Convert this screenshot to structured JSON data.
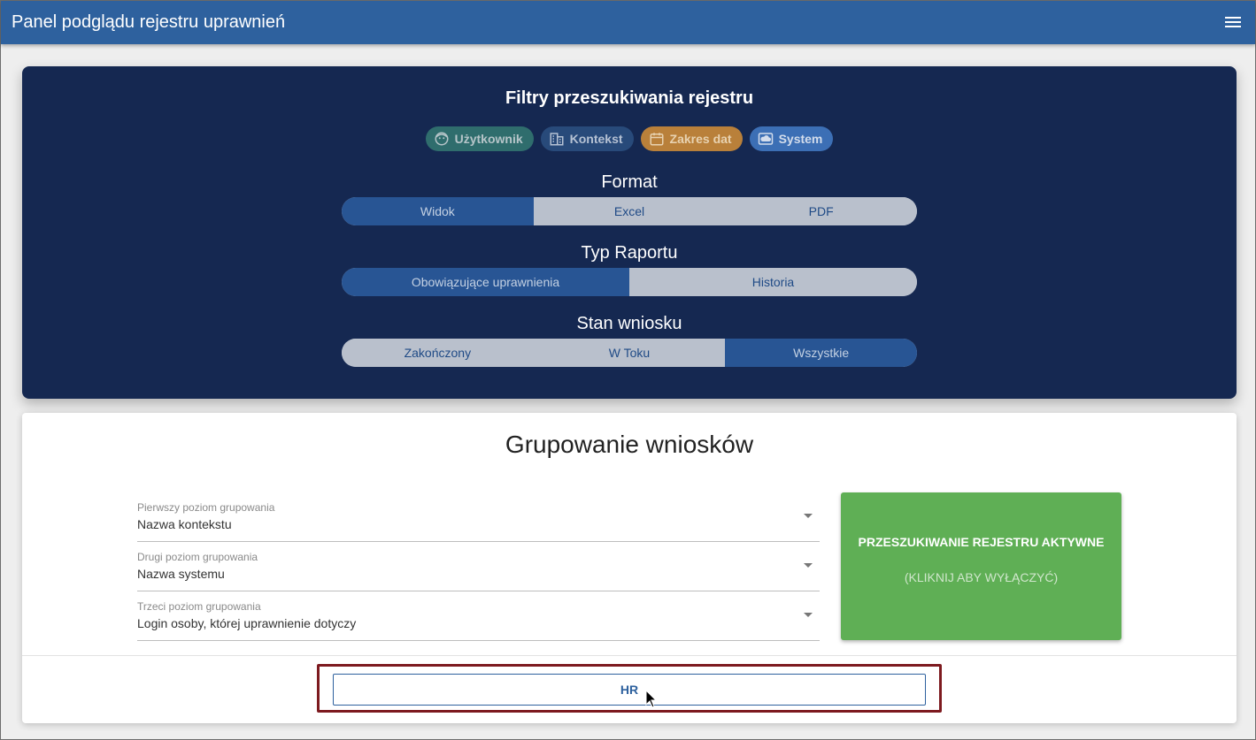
{
  "app_bar": {
    "title": "Panel podglądu rejestru uprawnień",
    "menu_icon": "hamburger-menu-icon"
  },
  "filters": {
    "title": "Filtry przeszukiwania rejestru",
    "chips": [
      {
        "label": "Użytkownik",
        "icon": "face-icon",
        "color": "#2f6d6d"
      },
      {
        "label": "Kontekst",
        "icon": "building-icon",
        "color": "#284a7a"
      },
      {
        "label": "Zakres dat",
        "icon": "calendar-icon",
        "color": "#b9803a"
      },
      {
        "label": "System",
        "icon": "cloud-icon",
        "color": "#3c6fb5"
      }
    ],
    "format": {
      "label": "Format",
      "options": [
        "Widok",
        "Excel",
        "PDF"
      ],
      "selected": "Widok"
    },
    "report_type": {
      "label": "Typ Raportu",
      "options": [
        "Obowiązujące uprawnienia",
        "Historia"
      ],
      "selected": "Obowiązujące uprawnienia"
    },
    "request_state": {
      "label": "Stan wniosku",
      "options": [
        "Zakończony",
        "W Toku",
        "Wszystkie"
      ],
      "selected": "Wszystkie"
    }
  },
  "grouping": {
    "title": "Grupowanie wniosków",
    "levels": [
      {
        "label": "Pierwszy poziom grupowania",
        "value": "Nazwa kontekstu"
      },
      {
        "label": "Drugi poziom grupowania",
        "value": "Nazwa systemu"
      },
      {
        "label": "Trzeci poziom grupowania",
        "value": "Login osoby, której uprawnienie dotyczy"
      }
    ],
    "search_toggle": {
      "title": "PRZESZUKIWANIE REJESTRU AKTYWNE",
      "subtitle": "(KLIKNIJ ABY WYŁĄCZYĆ)",
      "color": "#5faf55"
    },
    "hr_button_label": "HR"
  },
  "colors": {
    "app_bar": "#2e619e",
    "filters_background": "#152851",
    "highlight_border": "#7d1a1f"
  }
}
